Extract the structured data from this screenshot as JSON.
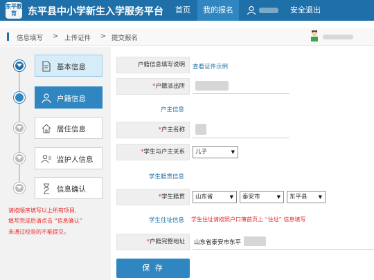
{
  "header": {
    "logo_text": "东平教育",
    "title": "东平县中小学新生入学服务平台",
    "nav_home": "首页",
    "nav_my_apply": "我的报名",
    "nav_logout": "安全退出",
    "color_bar": "#1f6fa8"
  },
  "breadcrumb": {
    "step1": "信息填写",
    "sep1": ">",
    "step2": "上传证件",
    "sep2": ">",
    "step3": "提交报名"
  },
  "sidebar": {
    "steps": [
      {
        "label": "基本信息",
        "icon": "document-icon",
        "state": "done"
      },
      {
        "label": "户籍信息",
        "icon": "person-icon",
        "state": "active"
      },
      {
        "label": "居住信息",
        "icon": "home-icon",
        "state": "todo"
      },
      {
        "label": "监护人信息",
        "icon": "guardian-icon",
        "state": "todo"
      },
      {
        "label": "信息确认",
        "icon": "hourglass-icon",
        "state": "todo"
      }
    ],
    "notes": [
      "请按顺序填写以上所有项目,",
      "填写完成后请点击 “信息确认”",
      "未通过校验的不能提交。"
    ]
  },
  "form": {
    "row1_label": "户籍信息填写说明",
    "row1_link": "查看证件示例",
    "row2_label": "户籍派出所",
    "section_household": "户主信息",
    "row3_label": "户主名称",
    "row4_label": "学生与户主关系",
    "relation_value": "儿子",
    "section_origin": "学生籍贯信息",
    "row5_label": "学生籍贯",
    "origin_province": "山东省",
    "origin_city": "泰安市",
    "origin_county": "东平县",
    "section_address": "学生住址信息",
    "address_hint": "学生住址请按照户口簿首页上 “住址” 信息填写",
    "row6_label": "户籍完整地址",
    "address_value": "山东省泰安市东平",
    "required_mark": "*",
    "save_label": "保 存"
  }
}
